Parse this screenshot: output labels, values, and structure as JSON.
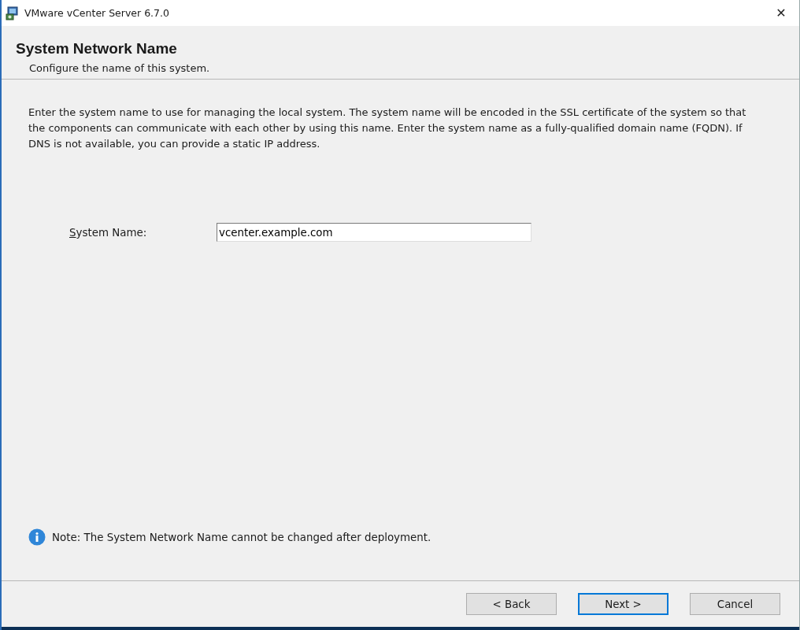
{
  "window": {
    "title": "VMware vCenter Server 6.7.0",
    "close": "✕"
  },
  "header": {
    "title": "System Network Name",
    "subtitle": "Configure the name of this system."
  },
  "description": "Enter the system name to use for managing the local system. The system name will be encoded in the SSL certificate of the system so that the components can communicate with each other by using this name. Enter the system name as a fully-qualified domain name (FQDN). If DNS is not available, you can provide a static IP address.",
  "field": {
    "label": "System Name:",
    "first_letter_underlined": true,
    "value": "vcenter.example.com"
  },
  "note": "Note: The System Network Name cannot be changed after deployment.",
  "buttons": [
    {
      "label": "< Back",
      "default": false
    },
    {
      "label": "Next >",
      "default": true
    },
    {
      "label": "Cancel",
      "default": false
    }
  ]
}
